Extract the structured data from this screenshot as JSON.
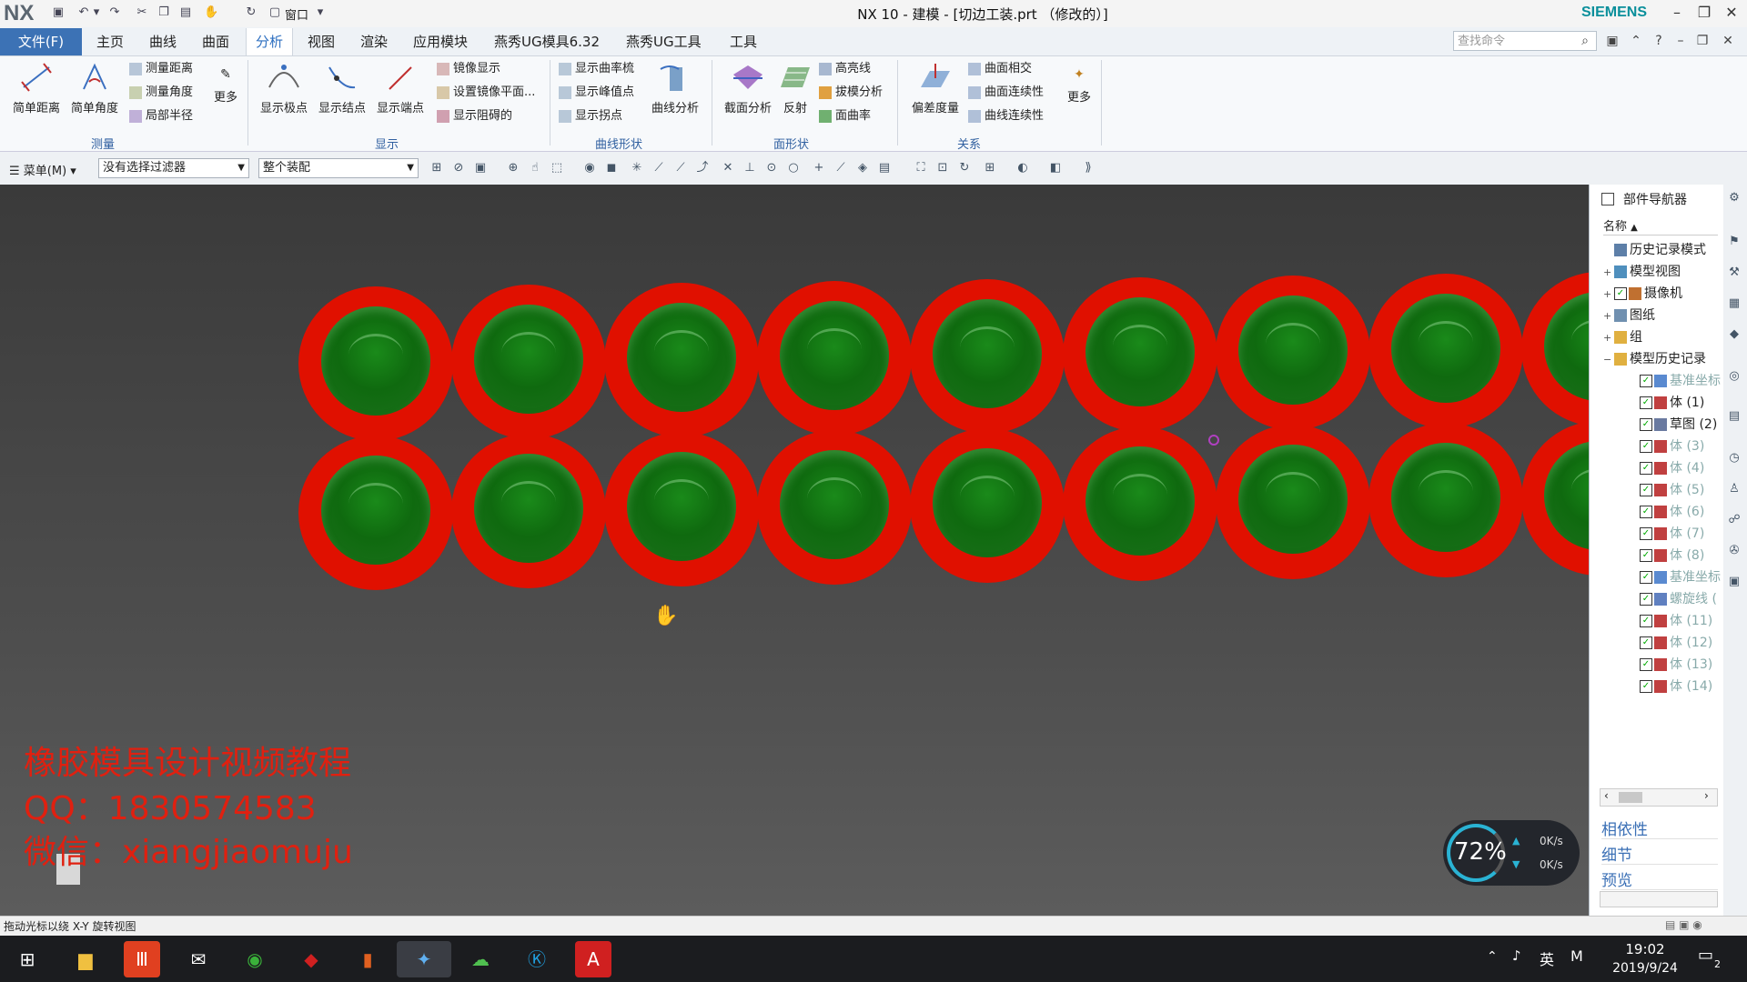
{
  "app": {
    "title": "NX 10 - 建模 - [切边工装.prt （修改的）]",
    "logo": "NX",
    "vendor": "SIEMENS",
    "window_menu": "窗口"
  },
  "menubar": {
    "file": "文件(F)",
    "tabs": [
      "主页",
      "曲线",
      "曲面",
      "分析",
      "视图",
      "渲染",
      "应用模块",
      "燕秀UG模具6.32",
      "燕秀UG工具",
      "工具"
    ],
    "active_tab": "分析",
    "search_placeholder": "查找命令"
  },
  "ribbon": {
    "measure": {
      "label": "测量",
      "big": [
        "简单距离",
        "简单角度"
      ],
      "small": [
        "测量距离",
        "测量角度",
        "局部半径"
      ],
      "more": "更多"
    },
    "display": {
      "label": "显示",
      "big": [
        "显示极点",
        "显示结点",
        "显示端点"
      ],
      "small": [
        "镜像显示",
        "设置镜像平面...",
        "显示阻碍的"
      ]
    },
    "curve_shape": {
      "label": "曲线形状",
      "small": [
        "显示曲率梳",
        "显示峰值点",
        "显示拐点"
      ],
      "big": [
        "曲线分析"
      ]
    },
    "face_shape": {
      "label": "面形状",
      "big": [
        "截面分析",
        "反射"
      ],
      "small": [
        "高亮线",
        "拔模分析",
        "面曲率"
      ]
    },
    "relation": {
      "label": "关系",
      "big": [
        "偏差度量"
      ],
      "small": [
        "曲面相交",
        "曲面连续性",
        "曲线连续性"
      ],
      "more": "更多"
    }
  },
  "toolbar": {
    "menu": "菜单(M)",
    "filter": "没有选择过滤器",
    "assembly": "整个装配"
  },
  "viewport": {
    "rows": 2,
    "columns_visible": 9,
    "ring_color": "#e01000",
    "cup_color": "#127312",
    "background": "#474747"
  },
  "watermark": {
    "line1": "橡胶模具设计视频教程",
    "line2": "QQ：1830574583",
    "line3": "微信：xiangjiaomuju"
  },
  "navigator": {
    "title": "部件导航器",
    "column": "名称",
    "items": [
      {
        "label": "历史记录模式",
        "expand": "",
        "check": false,
        "dim": false
      },
      {
        "label": "模型视图",
        "expand": "+",
        "check": false,
        "dim": false
      },
      {
        "label": "摄像机",
        "expand": "+",
        "check": true,
        "dim": false
      },
      {
        "label": "图纸",
        "expand": "+",
        "check": false,
        "dim": false
      },
      {
        "label": "组",
        "expand": "+",
        "check": false,
        "dim": false
      },
      {
        "label": "模型历史记录",
        "expand": "−",
        "check": false,
        "dim": false
      },
      {
        "label": "基准坐标",
        "expand": "",
        "check": true,
        "dim": true
      },
      {
        "label": "体 (1)",
        "expand": "",
        "check": true,
        "dim": false
      },
      {
        "label": "草图 (2)",
        "expand": "",
        "check": true,
        "dim": false
      },
      {
        "label": "体 (3)",
        "expand": "",
        "check": true,
        "dim": true
      },
      {
        "label": "体 (4)",
        "expand": "",
        "check": true,
        "dim": true
      },
      {
        "label": "体 (5)",
        "expand": "",
        "check": true,
        "dim": true
      },
      {
        "label": "体 (6)",
        "expand": "",
        "check": true,
        "dim": true
      },
      {
        "label": "体 (7)",
        "expand": "",
        "check": true,
        "dim": true
      },
      {
        "label": "体 (8)",
        "expand": "",
        "check": true,
        "dim": true
      },
      {
        "label": "基准坐标",
        "expand": "",
        "check": true,
        "dim": true
      },
      {
        "label": "螺旋线 (",
        "expand": "",
        "check": true,
        "dim": true
      },
      {
        "label": "体 (11)",
        "expand": "",
        "check": true,
        "dim": true
      },
      {
        "label": "体 (12)",
        "expand": "",
        "check": true,
        "dim": true
      },
      {
        "label": "体 (13)",
        "expand": "",
        "check": true,
        "dim": true
      },
      {
        "label": "体 (14)",
        "expand": "",
        "check": true,
        "dim": true
      }
    ],
    "sections": [
      "相依性",
      "细节",
      "预览"
    ]
  },
  "status": {
    "text": "拖动光标以绕 X-Y 旋转视图"
  },
  "speed_widget": {
    "percent": "72%",
    "up": "0K/s",
    "down": "0K/s"
  },
  "taskbar": {
    "time": "19:02",
    "date": "2019/9/24",
    "ime": "英",
    "notifications": "2"
  }
}
